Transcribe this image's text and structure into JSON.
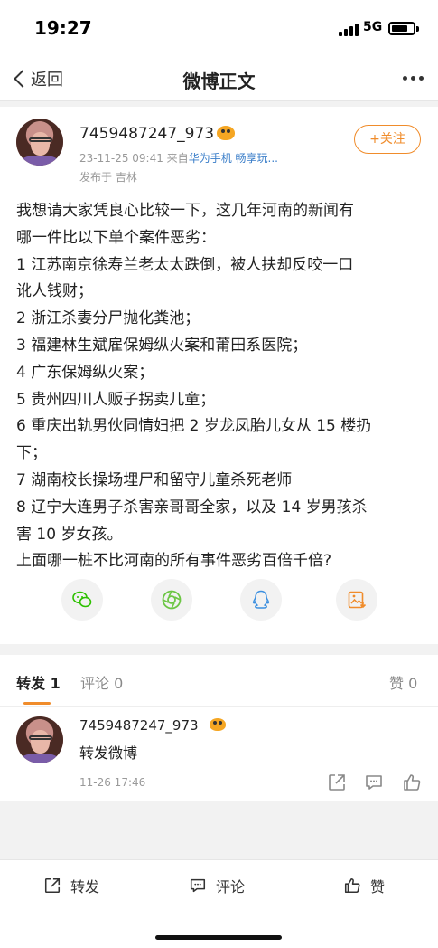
{
  "status_bar": {
    "time": "19:27",
    "network": "5G"
  },
  "nav": {
    "back_label": "返回",
    "title": "微博正文"
  },
  "post": {
    "author": "7459487247_973",
    "meta_prefix": "23-11-25 09:41  来自",
    "device": "华为手机 畅享玩...",
    "location": "发布于 吉林",
    "follow_label": "+关注",
    "lines": [
      "我想请大家凭良心比较一下，这几年河南的新闻有",
      "哪一件比以下单个案件恶劣：",
      "1 江苏南京徐寿兰老太太跌倒，被人扶却反咬一口",
      "讹人钱财；",
      "2 浙江杀妻分尸抛化粪池；",
      "3 福建林生斌雇保姆纵火案和莆田系医院；",
      "4 广东保姆纵火案；",
      "5 贵州四川人贩子拐卖儿童；",
      "6 重庆出轨男伙同情妇把 2 岁龙凤胎儿女从 15 楼扔",
      "下；",
      "7 湖南校长操场埋尸和留守儿童杀死老师",
      "8 辽宁大连男子杀害亲哥哥全家，以及 14 岁男孩杀",
      "害 10 岁女孩。",
      "上面哪一桩不比河南的所有事件恶劣百倍千倍?"
    ],
    "share_targets": [
      "wechat-icon",
      "moments-icon",
      "qq-icon",
      "save-image-icon"
    ]
  },
  "tabs": {
    "repost": "转发 1",
    "comment": "评论 0",
    "like": "赞 0"
  },
  "repost": {
    "author": "7459487247_973",
    "text": "转发微博",
    "time": "11-26 17:46"
  },
  "bottom_bar": {
    "repost": "转发",
    "comment": "评论",
    "like": "赞"
  },
  "colors": {
    "accent": "#f08c2b",
    "link": "#3a7ec9",
    "wechat": "#2dc100",
    "qq": "#3b8fe0",
    "moments": "#6cc644"
  }
}
